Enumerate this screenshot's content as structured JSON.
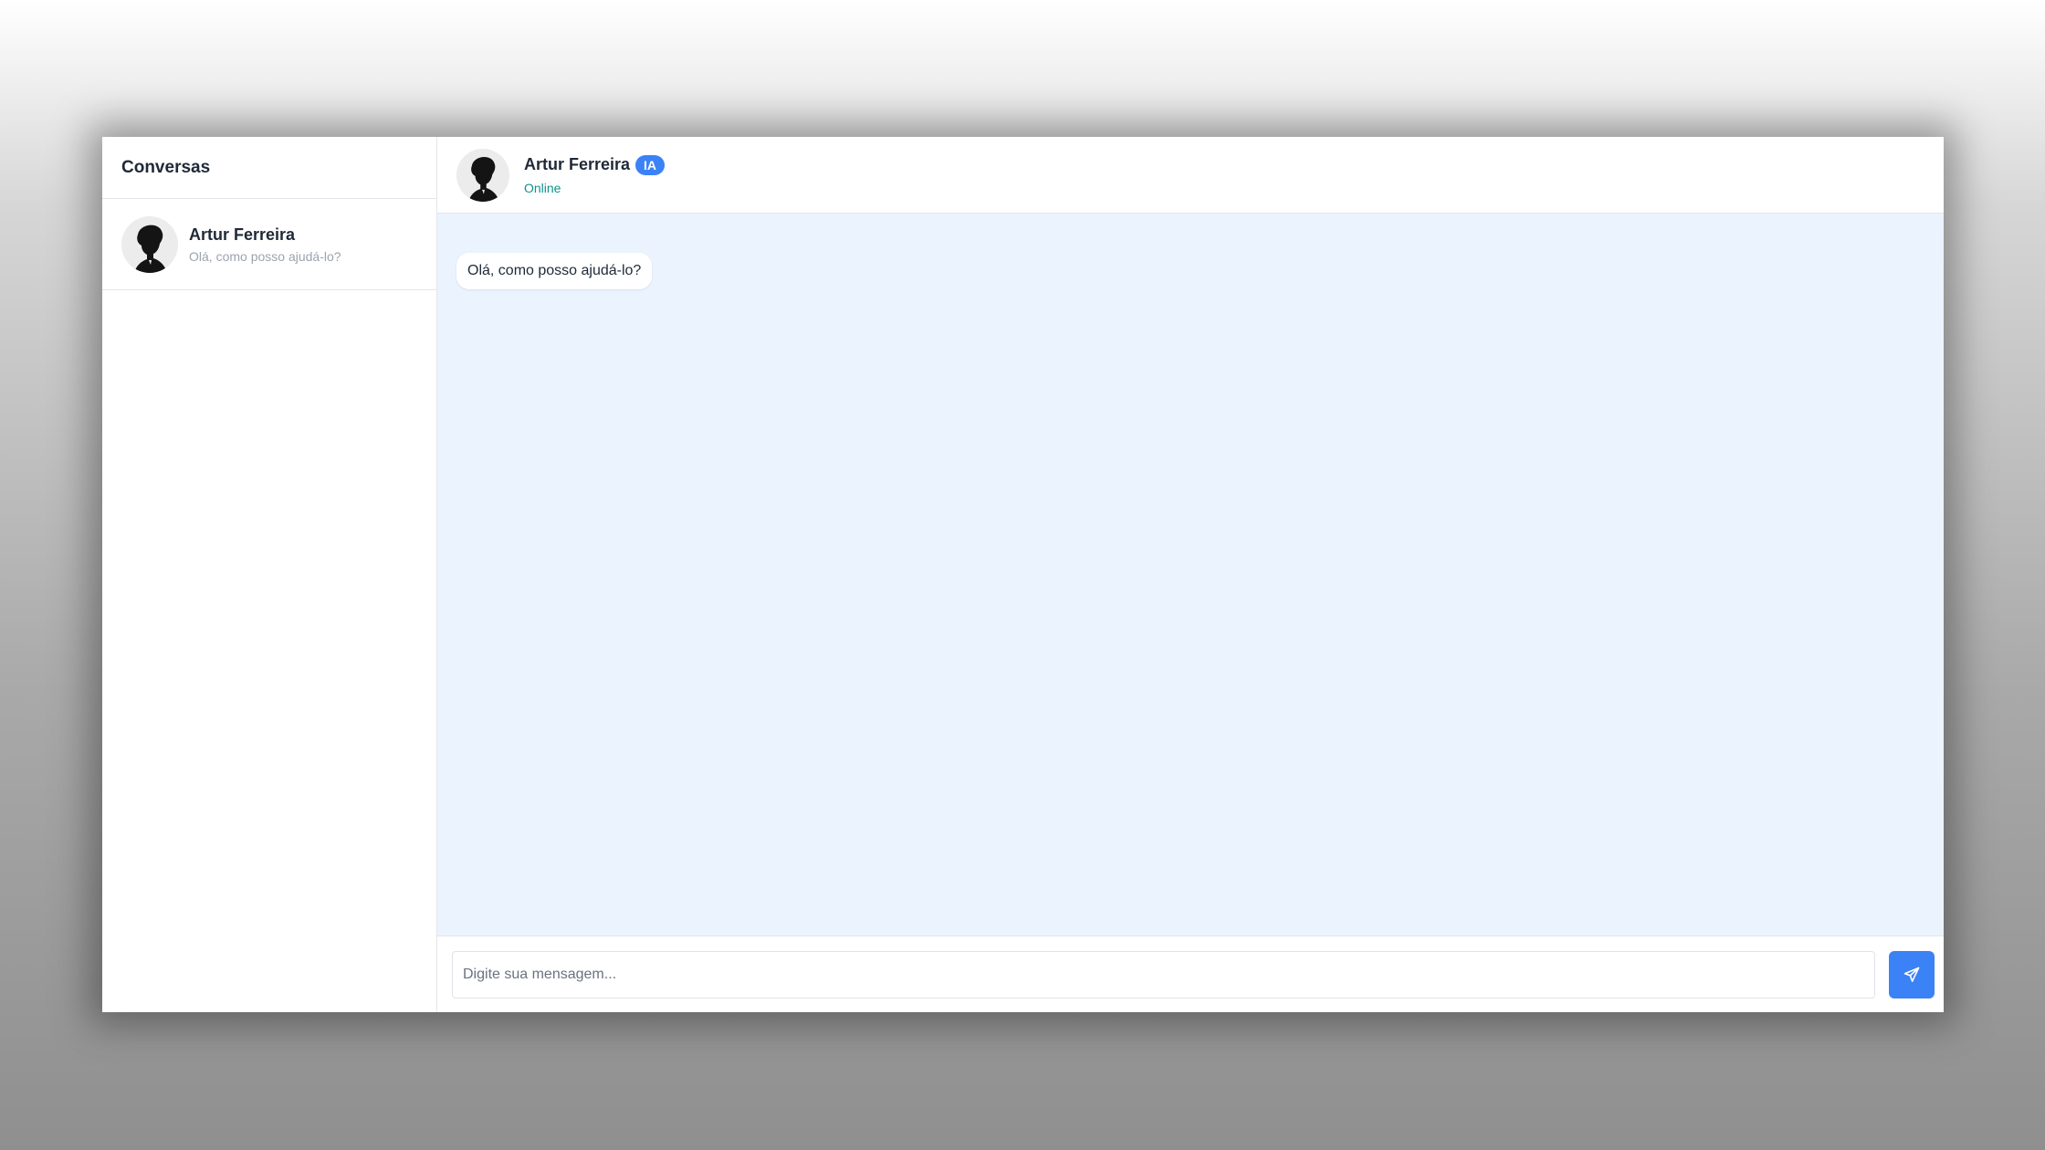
{
  "sidebar": {
    "title": "Conversas",
    "conversations": [
      {
        "name": "Artur Ferreira",
        "preview": "Olá, como posso ajudá-lo?"
      }
    ]
  },
  "chat": {
    "contact_name": "Artur Ferreira",
    "badge": "IA",
    "status": "Online",
    "messages": [
      {
        "text": "Olá, como posso ajudá-lo?"
      }
    ]
  },
  "composer": {
    "placeholder": "Digite sua mensagem...",
    "value": "",
    "send_icon": "send-icon"
  },
  "colors": {
    "accent": "#3b82f6",
    "status": "#0d9488",
    "chat_background": "#ebf3fe"
  }
}
